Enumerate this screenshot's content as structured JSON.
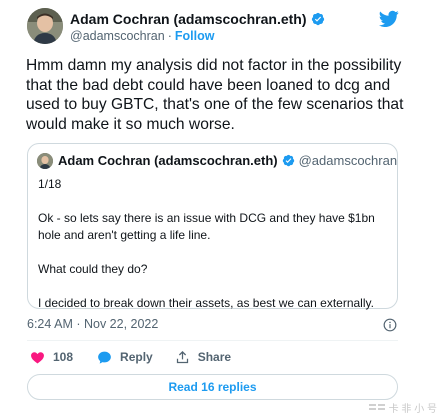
{
  "author": {
    "display_name": "Adam Cochran (adamscochran.eth)",
    "handle": "@adamscochran",
    "separator": "·",
    "follow_label": "Follow"
  },
  "tweet": {
    "text": "Hmm damn my analysis did not factor in the possibility that the bad debt could have been loaned to dcg and used to buy GBTC, that's one of the few scenarios that would make it so much worse.",
    "timestamp": "6:24 AM · Nov 22, 2022"
  },
  "quote": {
    "display_name": "Adam Cochran (adamscochran.eth)",
    "handle": "@adamscochran",
    "lines": [
      "1/18",
      "",
      "Ok - so lets say there is an issue with DCG and they have $1bn hole and aren't getting a life line.",
      "",
      "What could they do?",
      "",
      "I decided to break down their assets, as best we can externally."
    ]
  },
  "actions": {
    "likes_count": "108",
    "reply_label": "Reply",
    "share_label": "Share"
  },
  "replies_button_label": "Read 16 replies",
  "watermark": "卡 非 小 号",
  "colors": {
    "accent": "#1d9bf0",
    "like": "#f91880",
    "text": "#0f1419",
    "secondary": "#536471",
    "border": "#cfd9de"
  },
  "icons": [
    "verified-badge-icon",
    "twitter-bird-icon",
    "info-icon",
    "heart-icon",
    "reply-bubble-icon",
    "share-icon"
  ]
}
